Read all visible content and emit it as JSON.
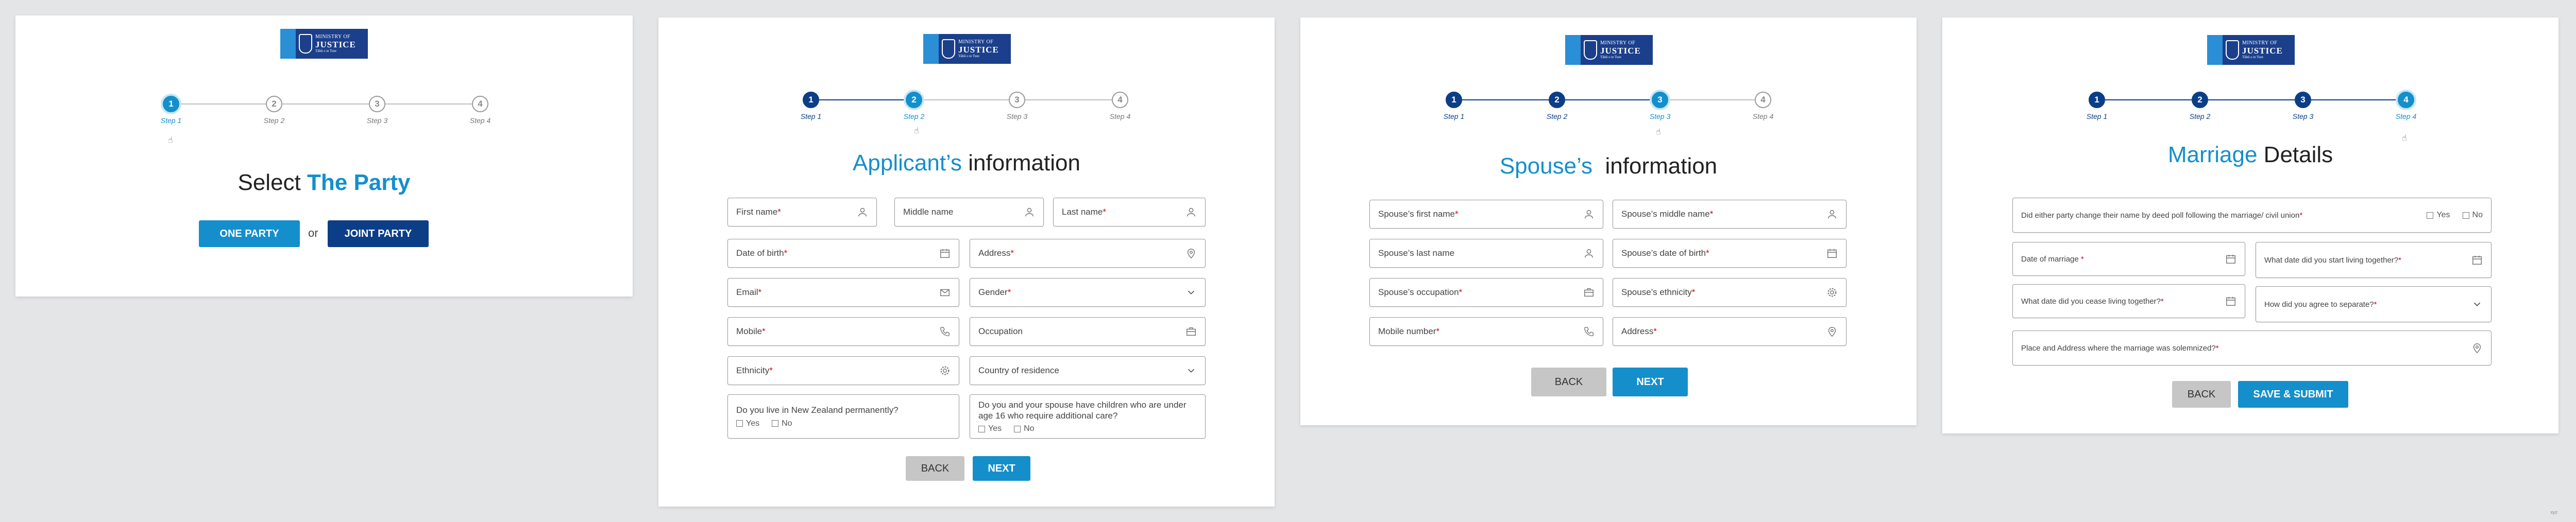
{
  "logo": {
    "line1": "MINISTRY OF",
    "line2": "JUSTICE",
    "line3": "Tāhū o te Ture"
  },
  "steps": [
    "1",
    "2",
    "3",
    "4"
  ],
  "step_labels": [
    "Step 1",
    "Step 2",
    "Step 3",
    "Step 4"
  ],
  "screen1": {
    "title_pre": "Select ",
    "title_hl": "The Party",
    "one_party": "ONE PARTY",
    "or": "or",
    "joint_party": "JOINT PARTY"
  },
  "screen2": {
    "title_hl": "Applicant’s",
    "title_post": " information",
    "first_name": "First name",
    "middle_name": "Middle name",
    "last_name": "Last  name",
    "dob": "Date of birth",
    "address": "Address",
    "email": "Email",
    "gender": "Gender",
    "mobile": "Mobile",
    "occupation": "Occupation",
    "ethnicity": "Ethnicity",
    "country": "Country of residence",
    "q_nz": "Do you live in New Zealand permanently?",
    "q_children": "Do you and your spouse have children who are under age 16 who require additional care?",
    "yes": "Yes",
    "no": "No",
    "back": "BACK",
    "next": "NEXT"
  },
  "screen3": {
    "title_hl": "Spouse’s",
    "title_post": "  information",
    "first_name": "Spouse’s first name",
    "middle_name": "Spouse’s middle name",
    "last_name": "Spouse’s last name",
    "dob": "Spouse’s date of birth",
    "occupation": "Spouse’s occupation",
    "ethnicity": "Spouse’s ethnicity",
    "mobile": "Mobile number",
    "address": "Address",
    "back": "BACK",
    "next": "NEXT"
  },
  "screen4": {
    "title_hl": "Marriage",
    "title_post": " Details",
    "q_name_change": "Did either party change their name by deed poll following the marriage/ civil union",
    "yes": "Yes",
    "no": "No",
    "date_marriage": "Date of marriage ",
    "start_living": "What date did you start living together?",
    "cease_living": "What date did you cease living together?",
    "separate": "How did you agree to separate?",
    "place": "Place and Address where the marriage was solemnized?",
    "back": "BACK",
    "submit": "SAVE & SUBMIT"
  },
  "signature": "xyz",
  "colors": {
    "accent": "#148fcc",
    "dark": "#0b3e87",
    "required": "#d0021b",
    "back": "#c6c6c6"
  }
}
